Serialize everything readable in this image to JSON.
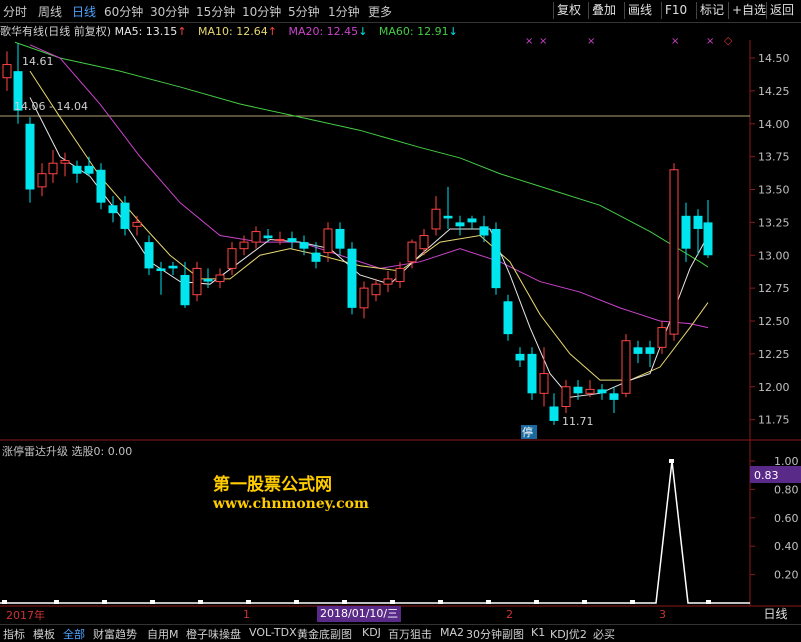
{
  "periods": [
    "分时",
    "周线",
    "日线",
    "60分钟",
    "30分钟",
    "15分钟",
    "10分钟",
    "5分钟",
    "1分钟",
    "更多"
  ],
  "active_period": "日线",
  "toolbar_buttons": [
    "复权",
    "叠加",
    "画线",
    "F10",
    "标记",
    "+自选",
    "返回"
  ],
  "legend": {
    "title": "歌华有线(日线 前复权)",
    "ma5": "MA5: 13.15",
    "ma10": "MA10: 12.64",
    "ma20": "MA20: 12.45",
    "ma60": "MA60: 12.91",
    "ma5_arrow": "↑",
    "ma10_arrow": "↑",
    "ma20_arrow": "↓",
    "ma60_arrow": "↓"
  },
  "price_axis_labels": [
    "14.50",
    "14.25",
    "14.00",
    "13.75",
    "13.50",
    "13.25",
    "13.00",
    "12.75",
    "12.50",
    "12.25",
    "12.00",
    "11.75"
  ],
  "annotations": {
    "high": "14.61",
    "low": "11.71",
    "hline": "14.06 - 14.04",
    "halt_mark": "停"
  },
  "indicator": {
    "label": "涨停雷达升级 选股0: 0.00",
    "value_badge": "0.83",
    "axis_labels": [
      "1.00",
      "0.80",
      "0.60",
      "0.40",
      "0.20"
    ]
  },
  "watermark": {
    "line1": "第一股票公式网",
    "line2": "www.chnmoney.com"
  },
  "time_axis": {
    "year": "2017年",
    "date_flag": "2018/01/10/三",
    "markers": [
      "1",
      "2",
      "3"
    ]
  },
  "day_button": "日线",
  "bottom_tabs": [
    "指标",
    "模板",
    "全部",
    "财富趋势",
    "自用M",
    "橙子味操盘",
    "VOL-TDX",
    "黄金底副图",
    "KDJ",
    "百万狙击",
    "MA2",
    "30分钟副图",
    "K1",
    "KDJ优2",
    "必买"
  ],
  "active_bottom_tab": "全部",
  "colors": {
    "up": "#ff4444",
    "down": "#00e5ee",
    "ma5": "#e8e8e8",
    "ma10": "#e8d870",
    "ma20": "#cc44cc",
    "ma60": "#44cc44",
    "accent": "#4fa3ff"
  }
}
